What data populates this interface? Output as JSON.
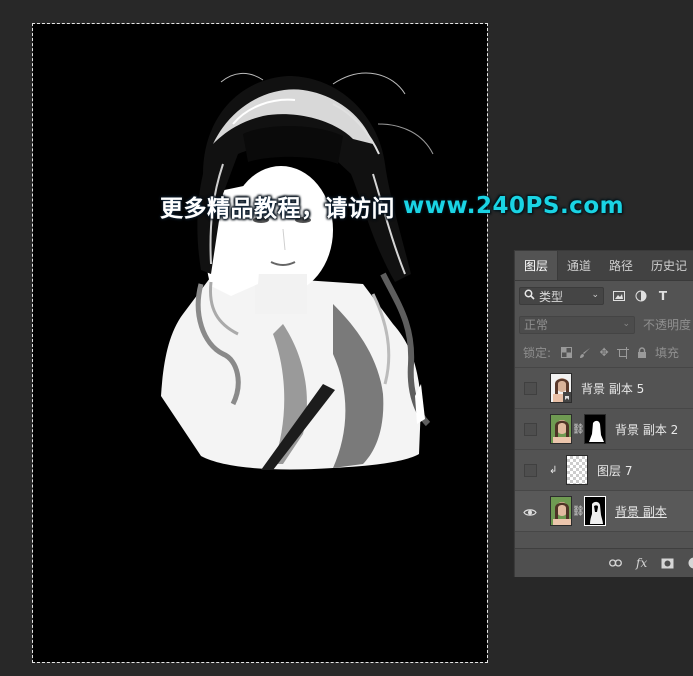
{
  "canvas": {
    "watermark_text": "更多精品教程，请访问",
    "watermark_url": "www.240PS.com"
  },
  "panel": {
    "tabs": [
      {
        "label": "图层",
        "active": true
      },
      {
        "label": "通道",
        "active": false
      },
      {
        "label": "路径",
        "active": false
      },
      {
        "label": "历史记",
        "active": false
      }
    ],
    "filter": {
      "label": "类型",
      "icons": [
        "image-icon",
        "adjustment-icon",
        "type-icon"
      ]
    },
    "blend_mode": "正常",
    "opacity_label": "不透明度",
    "lock_label": "锁定:",
    "fill_label": "填充",
    "layers": [
      {
        "name": "背景 副本 5",
        "visible": false,
        "has_mask": false,
        "clipped": false,
        "selected": false
      },
      {
        "name": "背景 副本 2",
        "visible": false,
        "has_mask": true,
        "clipped": false,
        "selected": false
      },
      {
        "name": "图层 7",
        "visible": false,
        "has_mask": false,
        "clipped": true,
        "selected": false
      },
      {
        "name": "背景 副本",
        "visible": true,
        "has_mask": true,
        "clipped": false,
        "selected": true
      }
    ],
    "bottom_icons": [
      "link-layers-icon",
      "fx-icon",
      "add-mask-icon",
      "adjustment-layer-icon"
    ],
    "colors": {
      "panel_bg": "#535353",
      "tabbar_bg": "#424242",
      "canvas_bg": "#000000",
      "watermark_url": "#1ad4e4"
    }
  }
}
